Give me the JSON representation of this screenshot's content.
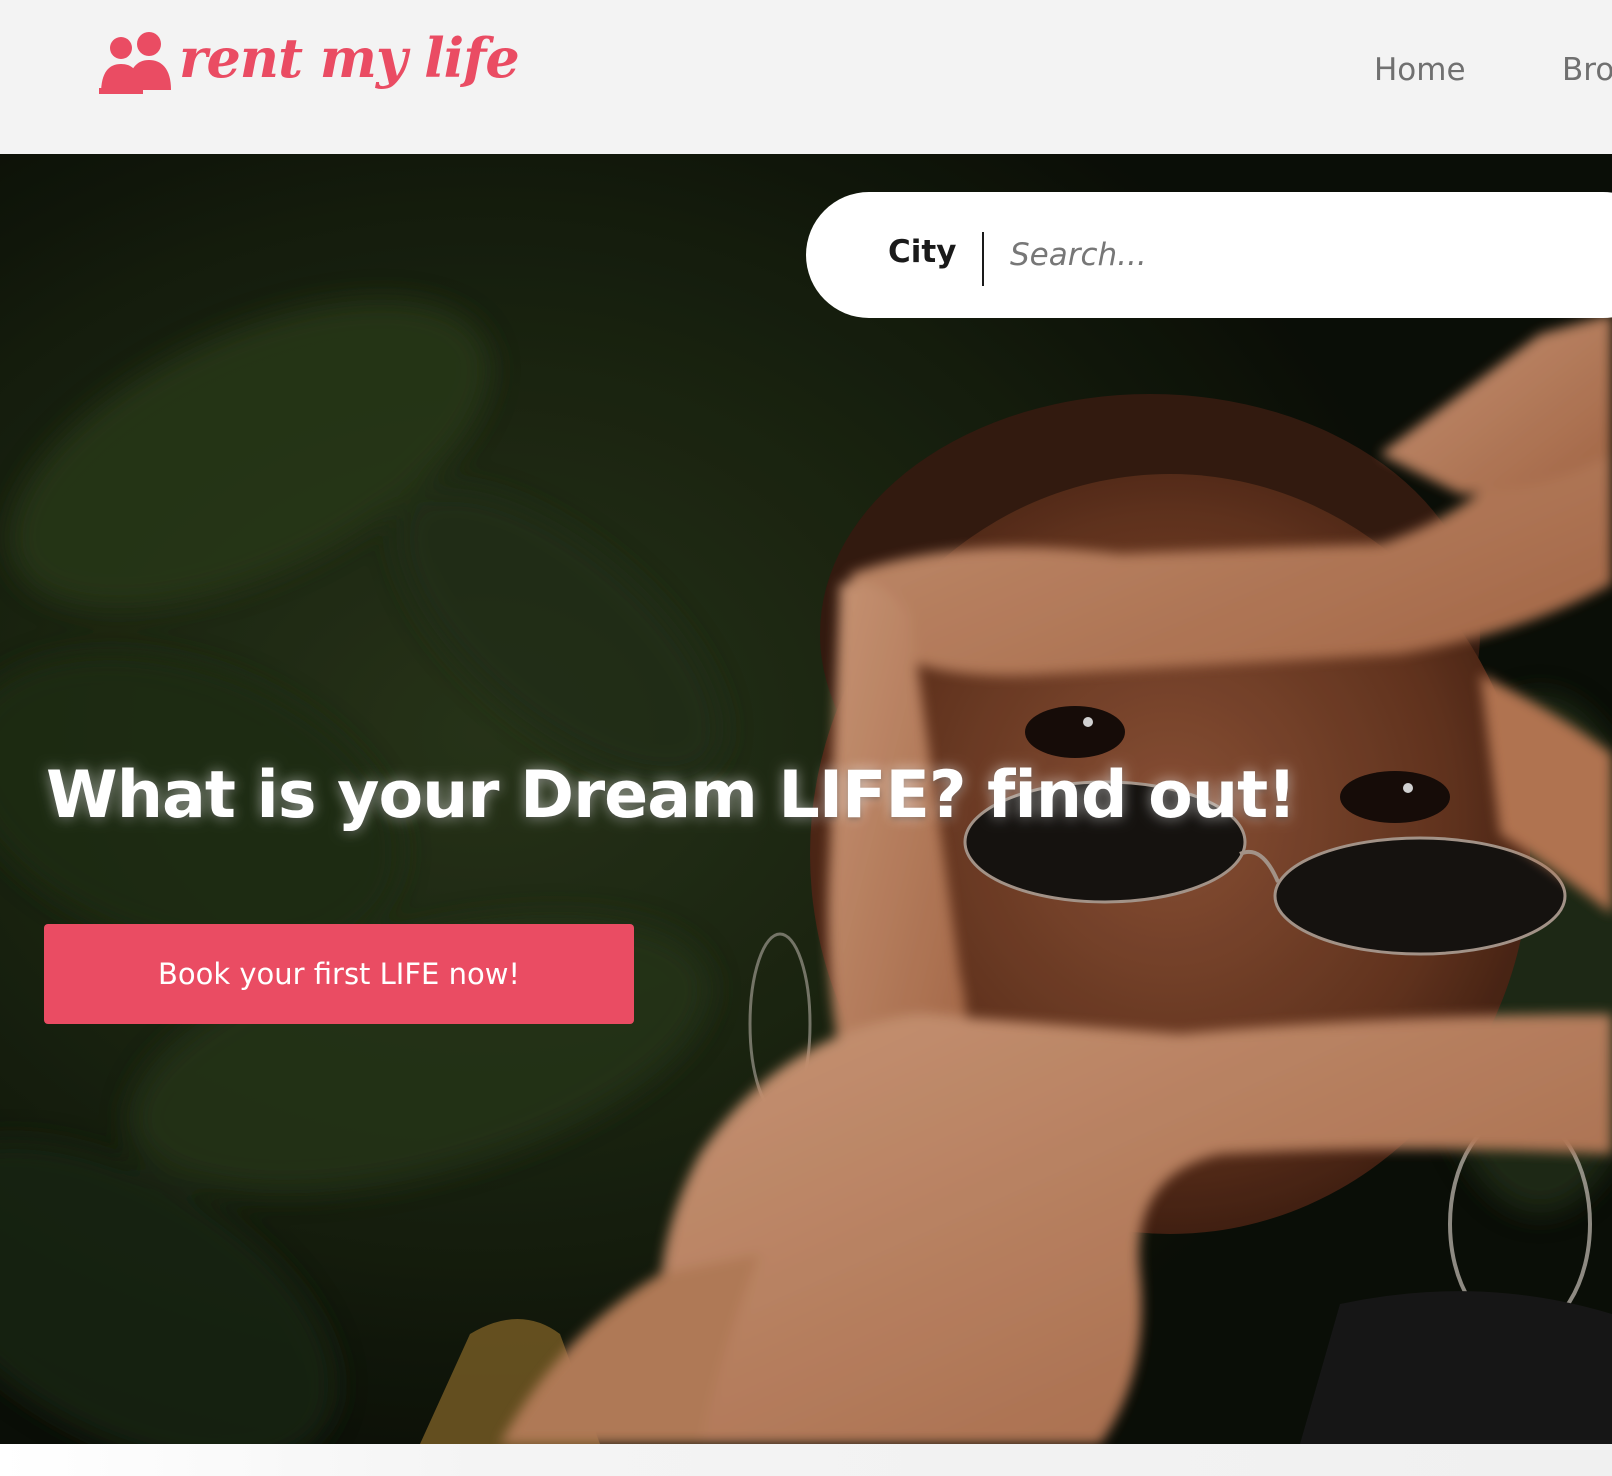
{
  "header": {
    "logo_text": "rent my life",
    "nav": {
      "home": "Home",
      "browse": "Bro"
    }
  },
  "hero": {
    "search": {
      "category_label": "City",
      "placeholder": "Search..."
    },
    "headline": "What is your Dream LIFE? find out!",
    "cta_label": "Book your first LIFE now!"
  },
  "colors": {
    "accent": "#ea4c63",
    "header_bg": "#f3f3f3",
    "nav_text": "#707070"
  },
  "icons": {
    "logo": "people-icon",
    "background": "hero-photo"
  }
}
